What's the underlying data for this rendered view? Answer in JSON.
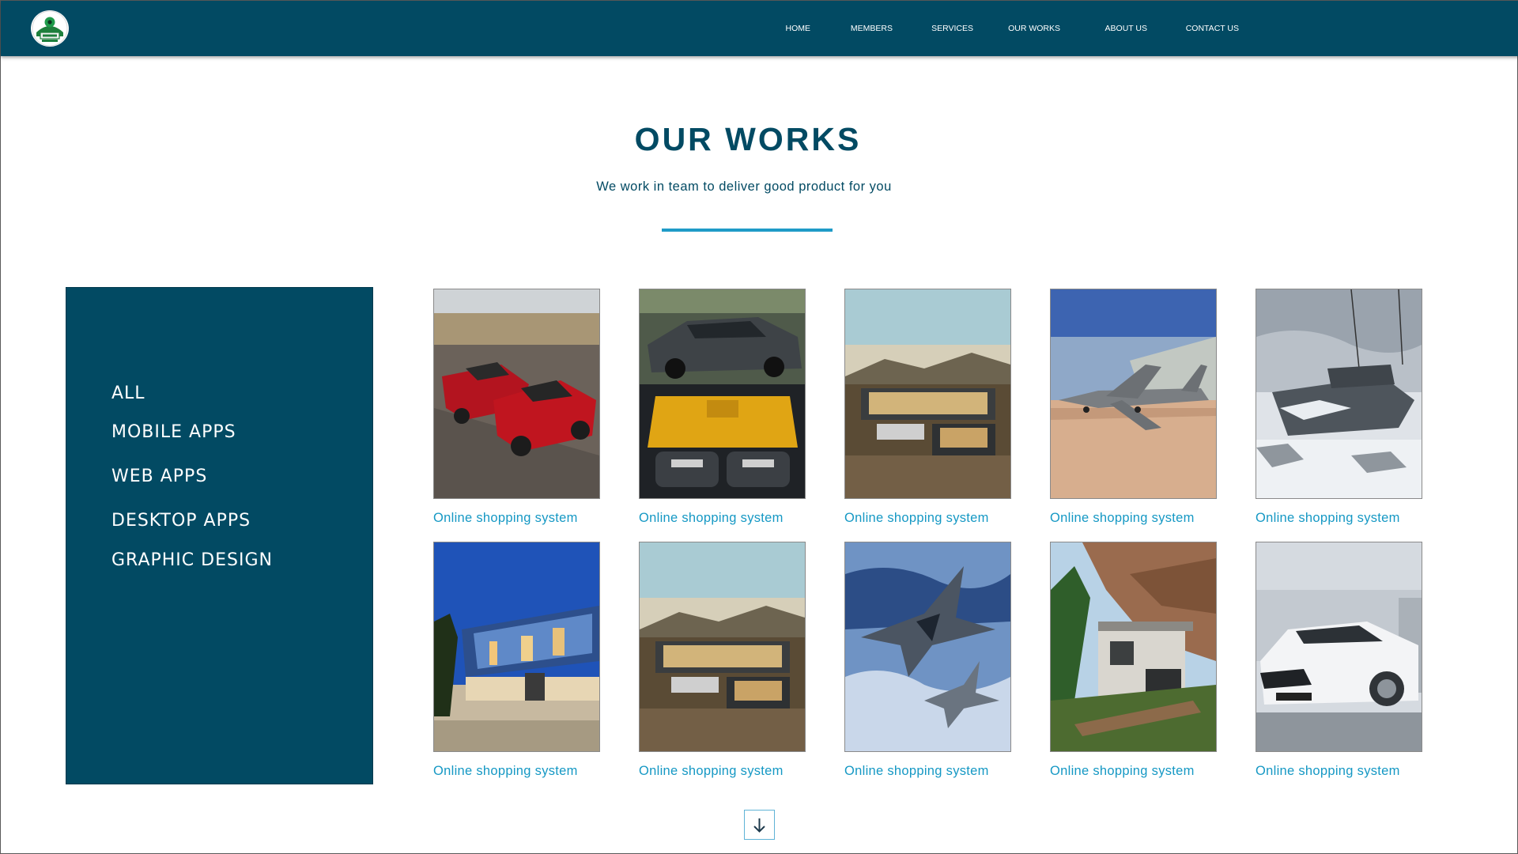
{
  "navbar": {
    "logo_icon": "team-logo-icon",
    "links": [
      "HOME",
      "MEMBERS",
      "SERVICES",
      "OUR WORKS",
      "ABOUT US",
      "CONTACT US"
    ]
  },
  "header": {
    "title": "OUR WORKS",
    "subtitle": "We work in team to deliver good product for you"
  },
  "sidebar": {
    "categories": [
      "ALL",
      "MOBILE APPS",
      "WEB APPS",
      "DESKTOP APPS",
      "GRAPHIC DESIGN"
    ]
  },
  "works": [
    {
      "caption": "Online shopping system",
      "image": "red-muscle-cars"
    },
    {
      "caption": "Online shopping system",
      "image": "grey-car-and-engine"
    },
    {
      "caption": "Online shopping system",
      "image": "modern-house-hillside"
    },
    {
      "caption": "Online shopping system",
      "image": "cargo-plane-desert"
    },
    {
      "caption": "Online shopping system",
      "image": "tank-in-snow"
    },
    {
      "caption": "Online shopping system",
      "image": "glass-house-dusk"
    },
    {
      "caption": "Online shopping system",
      "image": "modern-house-hillside"
    },
    {
      "caption": "Online shopping system",
      "image": "fighter-jets-sky"
    },
    {
      "caption": "Online shopping system",
      "image": "stone-villa-cliff"
    },
    {
      "caption": "Online shopping system",
      "image": "white-sports-car"
    }
  ],
  "scroll_button": {
    "icon": "arrow-down-icon"
  },
  "colors": {
    "nav_bg": "#024a63",
    "sidebar_bg": "#024a63",
    "title": "#024a63",
    "accent": "#1f9bc7",
    "caption": "#1598c4"
  }
}
